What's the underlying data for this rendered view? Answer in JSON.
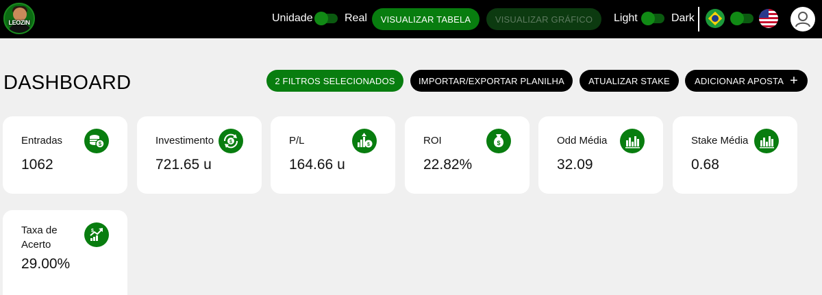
{
  "topbar": {
    "logo_text": "LEOZIN",
    "unidade_label": "Unidade",
    "real_label": "Real",
    "view_table_label": "VISUALIZAR TABELA",
    "view_chart_label": "VISUALIZAR GRÁFICO",
    "light_label": "Light",
    "dark_label": "Dark",
    "lang_left": "Português (Brasil)",
    "lang_right": "English (US)"
  },
  "header": {
    "title": "DASHBOARD",
    "filters_label": "2 FILTROS SELECIONADOS",
    "import_export_label": "IMPORTAR/EXPORTAR PLANILHA",
    "update_stake_label": "ATUALIZAR STAKE",
    "add_bet_label": "ADICIONAR APOSTA",
    "add_bet_plus": "+"
  },
  "cards": [
    {
      "label": "Entradas",
      "value": "1062",
      "icon": "coins-dollar-icon"
    },
    {
      "label": "Investimento",
      "value": "721.65 u",
      "icon": "cycle-dollar-icon"
    },
    {
      "label": "P/L",
      "value": "164.66 u",
      "icon": "growth-coin-icon"
    },
    {
      "label": "ROI",
      "value": "22.82%",
      "icon": "money-bag-icon"
    },
    {
      "label": "Odd Média",
      "value": "32.09",
      "icon": "bar-chart-icon"
    },
    {
      "label": "Stake Média",
      "value": "0.68",
      "icon": "bar-chart-icon"
    },
    {
      "label": "Taxa de Acerto",
      "value": "29.00%",
      "icon": "trend-up-icon"
    }
  ],
  "colors": {
    "accent": "#087d0f",
    "topbar": "#000000",
    "background": "#f0f0f0",
    "card": "#ffffff"
  }
}
